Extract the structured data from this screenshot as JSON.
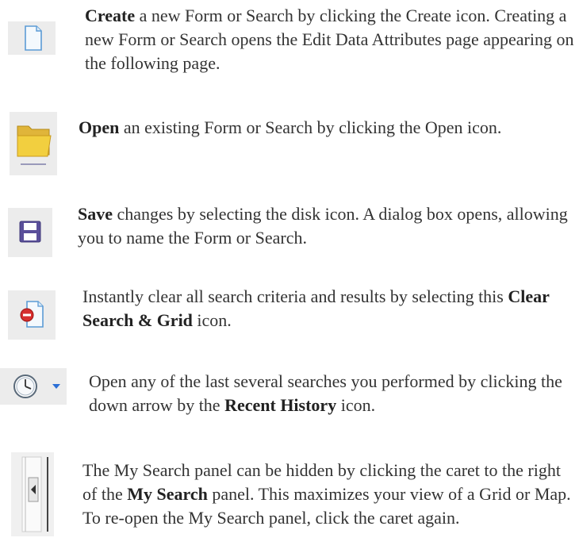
{
  "items": [
    {
      "icon": "new-document-icon",
      "bold": "Create",
      "after": " a new Form or Search by clicking the Create icon. Creating a new Form or Search opens the Edit Data Attributes page appearing on the following page."
    },
    {
      "icon": "open-folder-icon",
      "bold": "Open",
      "after": " an existing Form or Search by clicking the Open icon."
    },
    {
      "icon": "save-disk-icon",
      "bold": "Save",
      "after": " changes by selecting the disk icon. A dialog box opens, allowing you to name the Form or Search."
    },
    {
      "icon": "clear-search-grid-icon",
      "before": "Instantly clear all search criteria and results by selecting this ",
      "bold": "Clear Search & Grid",
      "after": " icon."
    },
    {
      "icon": "recent-history-clock-icon",
      "before": "Open any of the last several searches you performed by clicking the down arrow by the ",
      "bold": "Recent History",
      "after": " icon."
    },
    {
      "icon": "panel-caret-icon",
      "before": "The My Search panel can be hidden by clicking the caret to the right of the ",
      "bold": "My Search",
      "after": " panel. This maximizes your view of a Grid or Map. To re-open the My Search panel, click the caret again."
    }
  ]
}
